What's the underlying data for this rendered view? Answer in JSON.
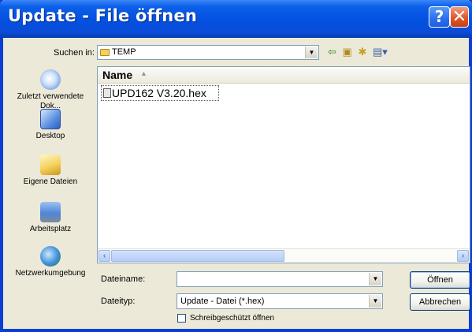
{
  "window": {
    "title": "Update - File öffnen",
    "help_button": "?",
    "close_button": "✕"
  },
  "lookin": {
    "label": "Suchen in:",
    "value": "TEMP"
  },
  "places": [
    {
      "label": "Zuletzt verwendete Dok...",
      "icon": "recent-documents-icon"
    },
    {
      "label": "Desktop",
      "icon": "desktop-icon"
    },
    {
      "label": "Eigene Dateien",
      "icon": "my-documents-icon"
    },
    {
      "label": "Arbeitsplatz",
      "icon": "my-computer-icon"
    },
    {
      "label": "Netzwerkumgebung",
      "icon": "network-icon"
    }
  ],
  "filelist": {
    "column_name": "Name",
    "files": [
      "UPD162 V3.20.hex"
    ]
  },
  "form": {
    "filename_label": "Dateiname:",
    "filename_value": "",
    "filetype_label": "Dateityp:",
    "filetype_value": "Update - Datei (*.hex)",
    "open_button": "Öffnen",
    "cancel_button": "Abbrechen",
    "readonly_label": "Schreibgeschützt öffnen"
  }
}
